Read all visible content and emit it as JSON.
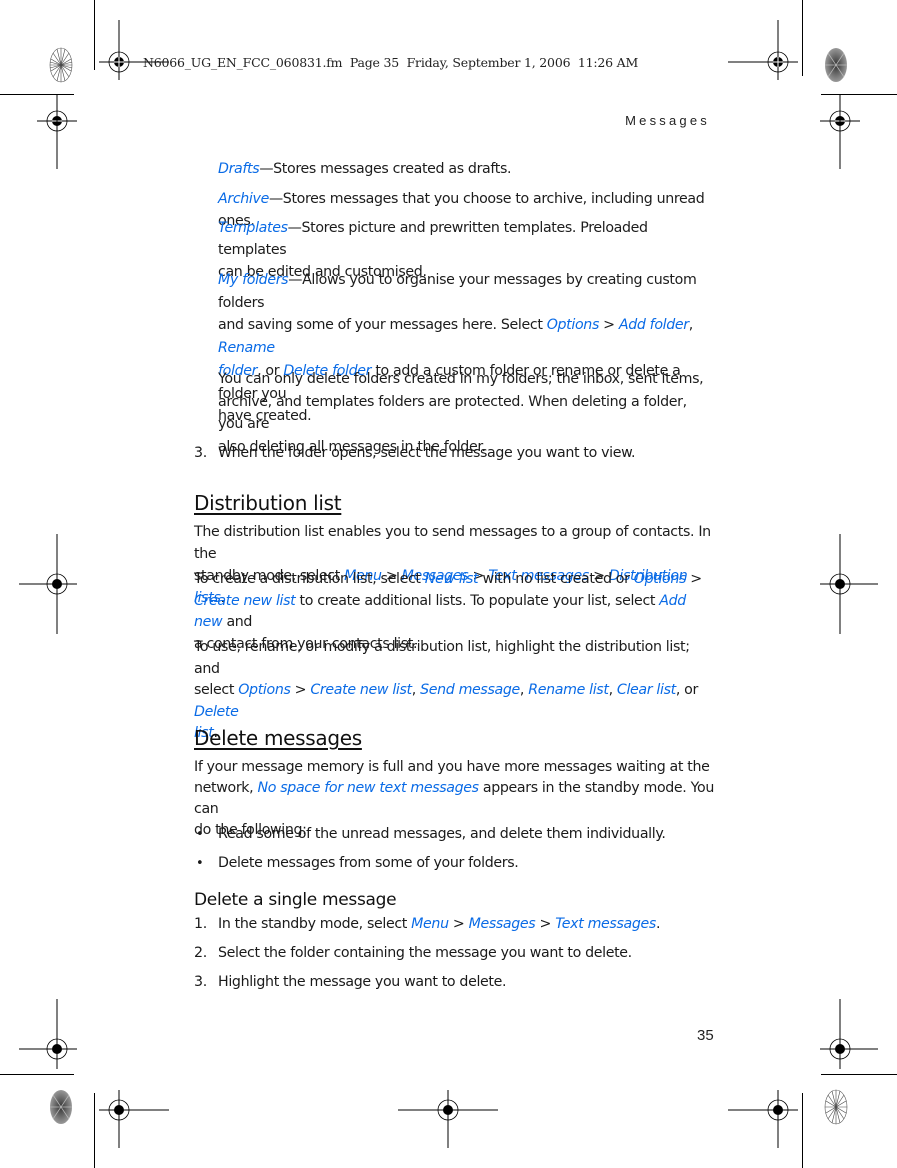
{
  "print_slug": "N6066_UG_EN_FCC_060831.fm  Page 35  Friday, September 1, 2006  11:26 AM",
  "running_head": "Messages",
  "page_number": "35",
  "link_color": "#0a6be6",
  "folders": {
    "drafts": {
      "term": "Drafts",
      "desc": "—Stores messages created as drafts."
    },
    "archive": {
      "term": "Archive",
      "desc": "—Stores messages that you choose to archive, including unread ones."
    },
    "templates": {
      "term": "Templates",
      "desc_line1": "—Stores picture and prewritten templates. Preloaded templates",
      "desc_line2": "can be edited and customised."
    },
    "my_folders": {
      "term": "My folders",
      "l1_text": "—Allows you to organise your messages by creating custom folders",
      "l2_text": "and saving some of your messages here. Select ",
      "l2_opt": "Options",
      "sep": " > ",
      "l2_add": "Add folder",
      "comma": ", ",
      "l2_rename": "Rename",
      "l3_folder": "folder",
      "l3_or": ", or ",
      "l3_delete": "Delete folder",
      "l3_text": " to add a custom folder or rename or delete a folder you",
      "l4_text": "have created."
    },
    "note_lines": [
      "You can only delete folders created in my folders; the inbox, sent items,",
      "archive, and templates folders are protected. When deleting a folder, you are",
      "also deleting all messages in the folder."
    ]
  },
  "step3": {
    "num": "3.",
    "text": "When the folder opens, select the message you want to view."
  },
  "distribution": {
    "heading": "Distribution list",
    "p1_l1": "The distribution list enables you to send messages to a group of contacts. In the",
    "p1_l2_a": "standby mode, select ",
    "menu": "Menu",
    "gt": " > ",
    "messages": "Messages",
    "text_messages": "Text messages",
    "distribution_lists": "Distribution lists",
    "period": ".",
    "p2_l1_a": "To create a distribution list, select ",
    "new_list": "New list",
    "p2_l1_b": " with no list created or ",
    "options": "Options",
    "p2_l1_c": " >",
    "create_new_list": "Create new list",
    "p2_l2_b": " to create additional lists. To populate your list, select ",
    "add_new": "Add new",
    "p2_l2_c": " and",
    "p2_l3": "a contact from your contacts list.",
    "p3_l1": "To use, rename, or modify a distribution list, highlight the distribution list; and",
    "p3_l2_a": "select ",
    "send_message": "Send message",
    "rename_list": "Rename list",
    "clear_list": "Clear list",
    "comma": ", ",
    "or": ", or ",
    "delete": "Delete",
    "list_word": "list"
  },
  "delete_messages": {
    "heading": "Delete messages",
    "p1_l1": "If your message memory is full and you have more messages waiting at the",
    "p1_l2_a": "network, ",
    "no_space": "No space for new text messages",
    "p1_l2_b": " appears in the standby mode. You can",
    "p1_l3": "do the following:",
    "bullets": [
      "Read some of the unread messages, and delete them individually.",
      "Delete messages from some of your folders."
    ],
    "bullet_char": "•"
  },
  "delete_single": {
    "heading": "Delete a single message",
    "steps": [
      {
        "num": "1.",
        "text_a": "In the standby mode, select ",
        "menu": "Menu",
        "gt": " > ",
        "messages": "Messages",
        "text_messages": "Text messages",
        "period": "."
      },
      {
        "num": "2.",
        "text": "Select the folder containing the message you want to delete."
      },
      {
        "num": "3.",
        "text": "Highlight the message you want to delete."
      }
    ]
  }
}
